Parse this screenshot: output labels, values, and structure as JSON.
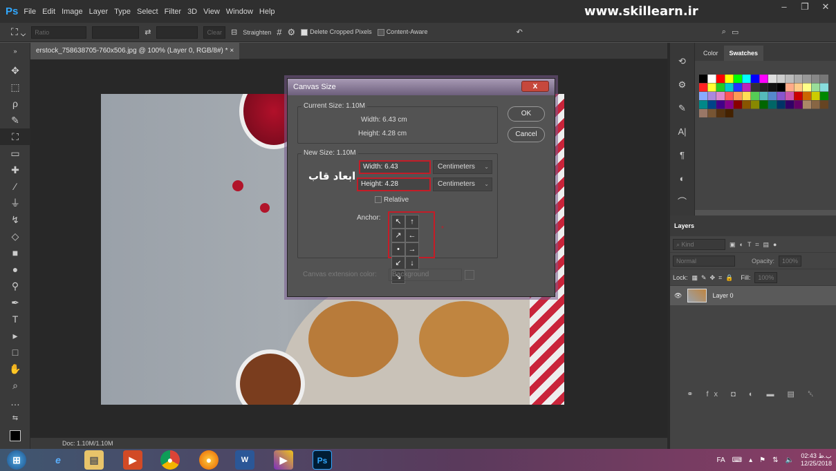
{
  "app": {
    "logo": "Ps",
    "watermark": "www.skillearn.ir"
  },
  "menu": [
    "File",
    "Edit",
    "Image",
    "Layer",
    "Type",
    "Select",
    "Filter",
    "3D",
    "View",
    "Window",
    "Help"
  ],
  "options": {
    "ratio": "Ratio",
    "clear": "Clear",
    "straighten": "Straighten",
    "delete_cropped": "Delete Cropped Pixels",
    "content_aware": "Content-Aware"
  },
  "document": {
    "tab": "erstock_758638705-760x506.jpg @ 100% (Layer 0, RGB/8#) *",
    "status": "Doc: 1.10M/1.10M"
  },
  "dialog": {
    "title": "Canvas Size",
    "current_label": "Current Size: 1.10M",
    "current_width": "Width:  6.43 cm",
    "current_height": "Height:  4.28 cm",
    "new_label": "New Size: 1.10M",
    "width_label": "Width:",
    "width_value": "6.43",
    "height_label": "Height:",
    "height_value": "4.28",
    "unit": "Centimeters",
    "relative": "Relative",
    "anchor": "Anchor:",
    "ext_color_label": "Canvas extension color:",
    "ext_color_value": "Background",
    "ok": "OK",
    "cancel": "Cancel",
    "annotation": "ابعاد قاب"
  },
  "swatches_tabs": [
    "Color",
    "Swatches"
  ],
  "layers": {
    "tab": "Layers",
    "kind": "Kind",
    "mode": "Normal",
    "opacity_label": "Opacity:",
    "opacity": "100%",
    "lock": "Lock:",
    "fill_label": "Fill:",
    "fill": "100%",
    "layer_name": "Layer 0"
  },
  "tray": {
    "lang": "FA",
    "time": "02:43 ب.ظ",
    "date": "12/25/2018"
  },
  "colors": {
    "accent_red": "#c51c27",
    "ps_blue": "#31a8ff"
  }
}
